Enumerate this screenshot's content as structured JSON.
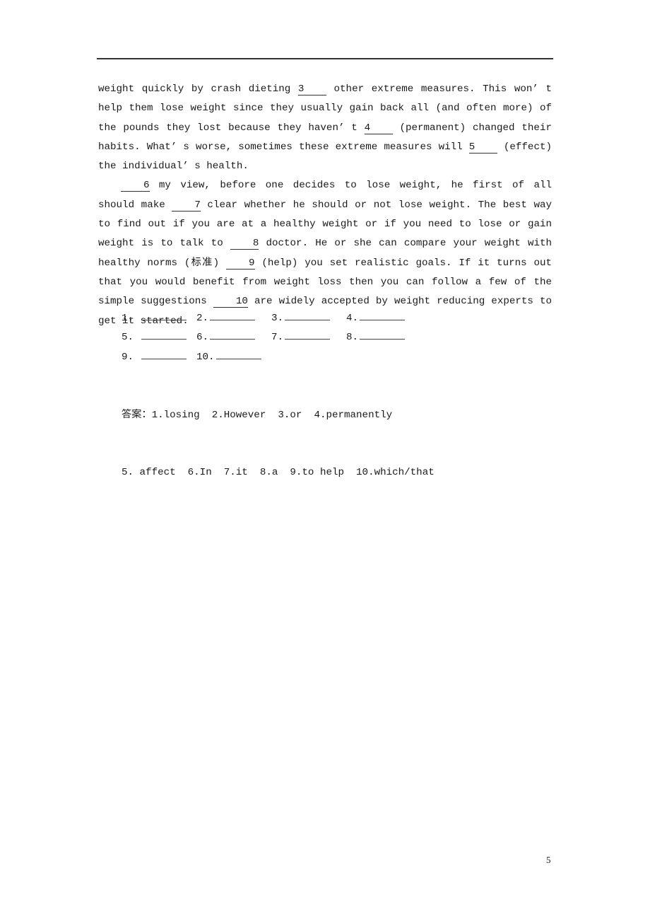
{
  "passage": {
    "paragraphs": [
      {
        "indent": false,
        "segments": [
          {
            "t": "weight quickly by crash dieting "
          },
          {
            "blank": "3"
          },
          {
            "t": " other extreme measures. This won’ t help them lose weight since they usually gain back all (and often more) of the pounds they lost because they haven’ t "
          },
          {
            "blank": "4"
          },
          {
            "t": " (permanent) changed their habits. What’ s worse, sometimes these extreme measures will "
          },
          {
            "blank": "5"
          },
          {
            "t": " (effect) the individual’ s health."
          }
        ]
      },
      {
        "indent": true,
        "segments": [
          {
            "blank": "6"
          },
          {
            "t": " my view, before one decides to lose weight, he first of all should make "
          },
          {
            "blank": "7"
          },
          {
            "t": " clear whether he should or not lose weight. The best way to find out if you are at a healthy weight or if you need to lose or gain weight is to talk to "
          },
          {
            "blank": "8"
          },
          {
            "t": " doctor. He or she can compare your weight with healthy norms (标准) "
          },
          {
            "blank": "9"
          },
          {
            "t": " (help) you set realistic goals. If it turns out that you would benefit from weight loss then you can follow a few of the simple suggestions "
          },
          {
            "blank": "10"
          },
          {
            "t": " are widely accepted by weight reducing experts to get it started."
          }
        ]
      }
    ]
  },
  "questions": {
    "rows": [
      [
        "1. ",
        "2.",
        "3.",
        "4."
      ],
      [
        "5. ",
        "6.",
        "7.",
        "8."
      ],
      [
        "9. ",
        "10."
      ]
    ]
  },
  "answers": {
    "line1": "答案：1.losing  2.However  3.or  4.permanently",
    "line2": "5. affect  6.In  7.it  8.a  9.to help  10.which/that"
  },
  "page_number": "5"
}
